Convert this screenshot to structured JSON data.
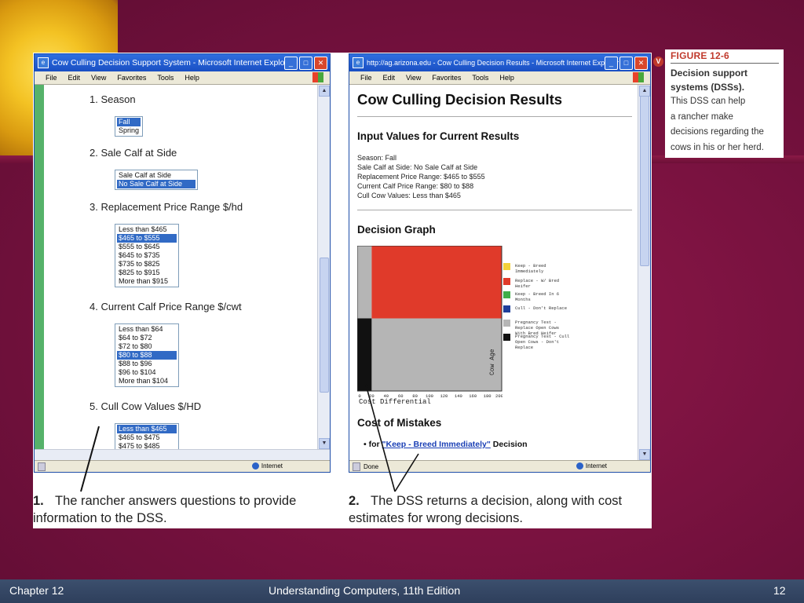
{
  "slide": {
    "footer_left": "Chapter 12",
    "footer_center": "Understanding Computers, 11th Edition",
    "footer_right": "12"
  },
  "figure": {
    "label": "FIGURE 12-6",
    "subtitle": "Decision support systems (DSSs).",
    "body_lines": [
      "This DSS can help",
      "a rancher make",
      "decisions regarding the",
      "cows in his or her herd."
    ],
    "icon": "v-badge-icon"
  },
  "left_window": {
    "title": "Cow Culling Decision Support System - Microsoft Internet Explorer",
    "menu": [
      "File",
      "Edit",
      "View",
      "Favorites",
      "Tools",
      "Help"
    ],
    "status": "Internet",
    "questions": [
      {
        "heading": "1. Season",
        "options": [
          "Fall",
          "Spring"
        ],
        "selected": 0
      },
      {
        "heading": "2. Sale Calf at Side",
        "options": [
          "Sale Calf at Side",
          "No Sale Calf at Side"
        ],
        "selected": 1
      },
      {
        "heading": "3. Replacement Price Range $/hd",
        "options": [
          "Less than $465",
          "$465 to $555",
          "$555 to $645",
          "$645 to $735",
          "$735 to $825",
          "$825 to $915",
          "More than $915"
        ],
        "selected": 1
      },
      {
        "heading": "4. Current Calf Price Range $/cwt",
        "options": [
          "Less than $64",
          "$64 to $72",
          "$72 to $80",
          "$80 to $88",
          "$88 to $96",
          "$96 to $104",
          "More than $104"
        ],
        "selected": 3
      },
      {
        "heading": "5. Cull Cow Values $/HD",
        "options": [
          "Less than $465",
          "$465 to $475",
          "$475 to $485"
        ],
        "selected": 0
      }
    ]
  },
  "right_window": {
    "title": "http://ag.arizona.edu - Cow Culling Decision Results - Microsoft Internet Explorer",
    "menu": [
      "File",
      "Edit",
      "View",
      "Favorites",
      "Tools",
      "Help"
    ],
    "status_left": "Done",
    "status_right": "Internet",
    "page_title": "Cow Culling Decision Results",
    "input_heading": "Input Values for Current Results",
    "input_lines": [
      "Season: Fall",
      "Sale Calf at Side: No Sale Calf at Side",
      "Replacement Price Range: $465 to $555",
      "Current Calf Price Range: $80 to $88",
      "Cull Cow Values: Less than $465"
    ],
    "graph_heading": "Decision Graph",
    "mistakes_heading": "Cost of Mistakes",
    "mistake_prefix": "for",
    "mistake_link": "\"Keep - Breed Immediately\"",
    "mistake_suffix": "Decision"
  },
  "chart_data": {
    "type": "heatmap",
    "title": "Decision Graph",
    "xlabel": "Cost Differential",
    "ylabel": "Cow Age",
    "x_ticks": [
      "0",
      "20",
      "40",
      "60",
      "80",
      "100",
      "120",
      "140",
      "160",
      "180",
      "200"
    ],
    "xlim": [
      0,
      200
    ],
    "legend": [
      {
        "label": "Keep - Breed Immediately",
        "color": "#f2d13a"
      },
      {
        "label": "Replace - W/ Bred Heifer",
        "color": "#e03a2a"
      },
      {
        "label": "Keep - Breed In 6 Months",
        "color": "#3fae49"
      },
      {
        "label": "Cull - Don't Replace",
        "color": "#1f3f9a"
      },
      {
        "label": "Pregnancy Test - Replace Open Cows With Bred Heifer",
        "color": "#b5b5b5"
      },
      {
        "label": "Pregnancy Test - Cull Open Cows - Don't Replace",
        "color": "#111111"
      }
    ],
    "regions": [
      {
        "decision": "Pregnancy Test - Replace Open Cows With Bred Heifer",
        "x_range": [
          0,
          20
        ],
        "y_range": [
          0.5,
          1.0
        ]
      },
      {
        "decision": "Replace - W/ Bred Heifer",
        "x_range": [
          20,
          200
        ],
        "y_range": [
          0.5,
          1.0
        ]
      },
      {
        "decision": "Pregnancy Test - Cull Open Cows - Don't Replace",
        "x_range": [
          0,
          20
        ],
        "y_range": [
          0,
          0.5
        ]
      },
      {
        "decision": "Pregnancy Test - Replace Open Cows With Bred Heifer",
        "x_range": [
          20,
          200
        ],
        "y_range": [
          0,
          0.5
        ]
      }
    ]
  },
  "captions": [
    {
      "num": "1.",
      "text": "The rancher answers questions to provide information to the DSS."
    },
    {
      "num": "2.",
      "text": "The DSS returns a decision, along with cost estimates for wrong decisions."
    }
  ]
}
